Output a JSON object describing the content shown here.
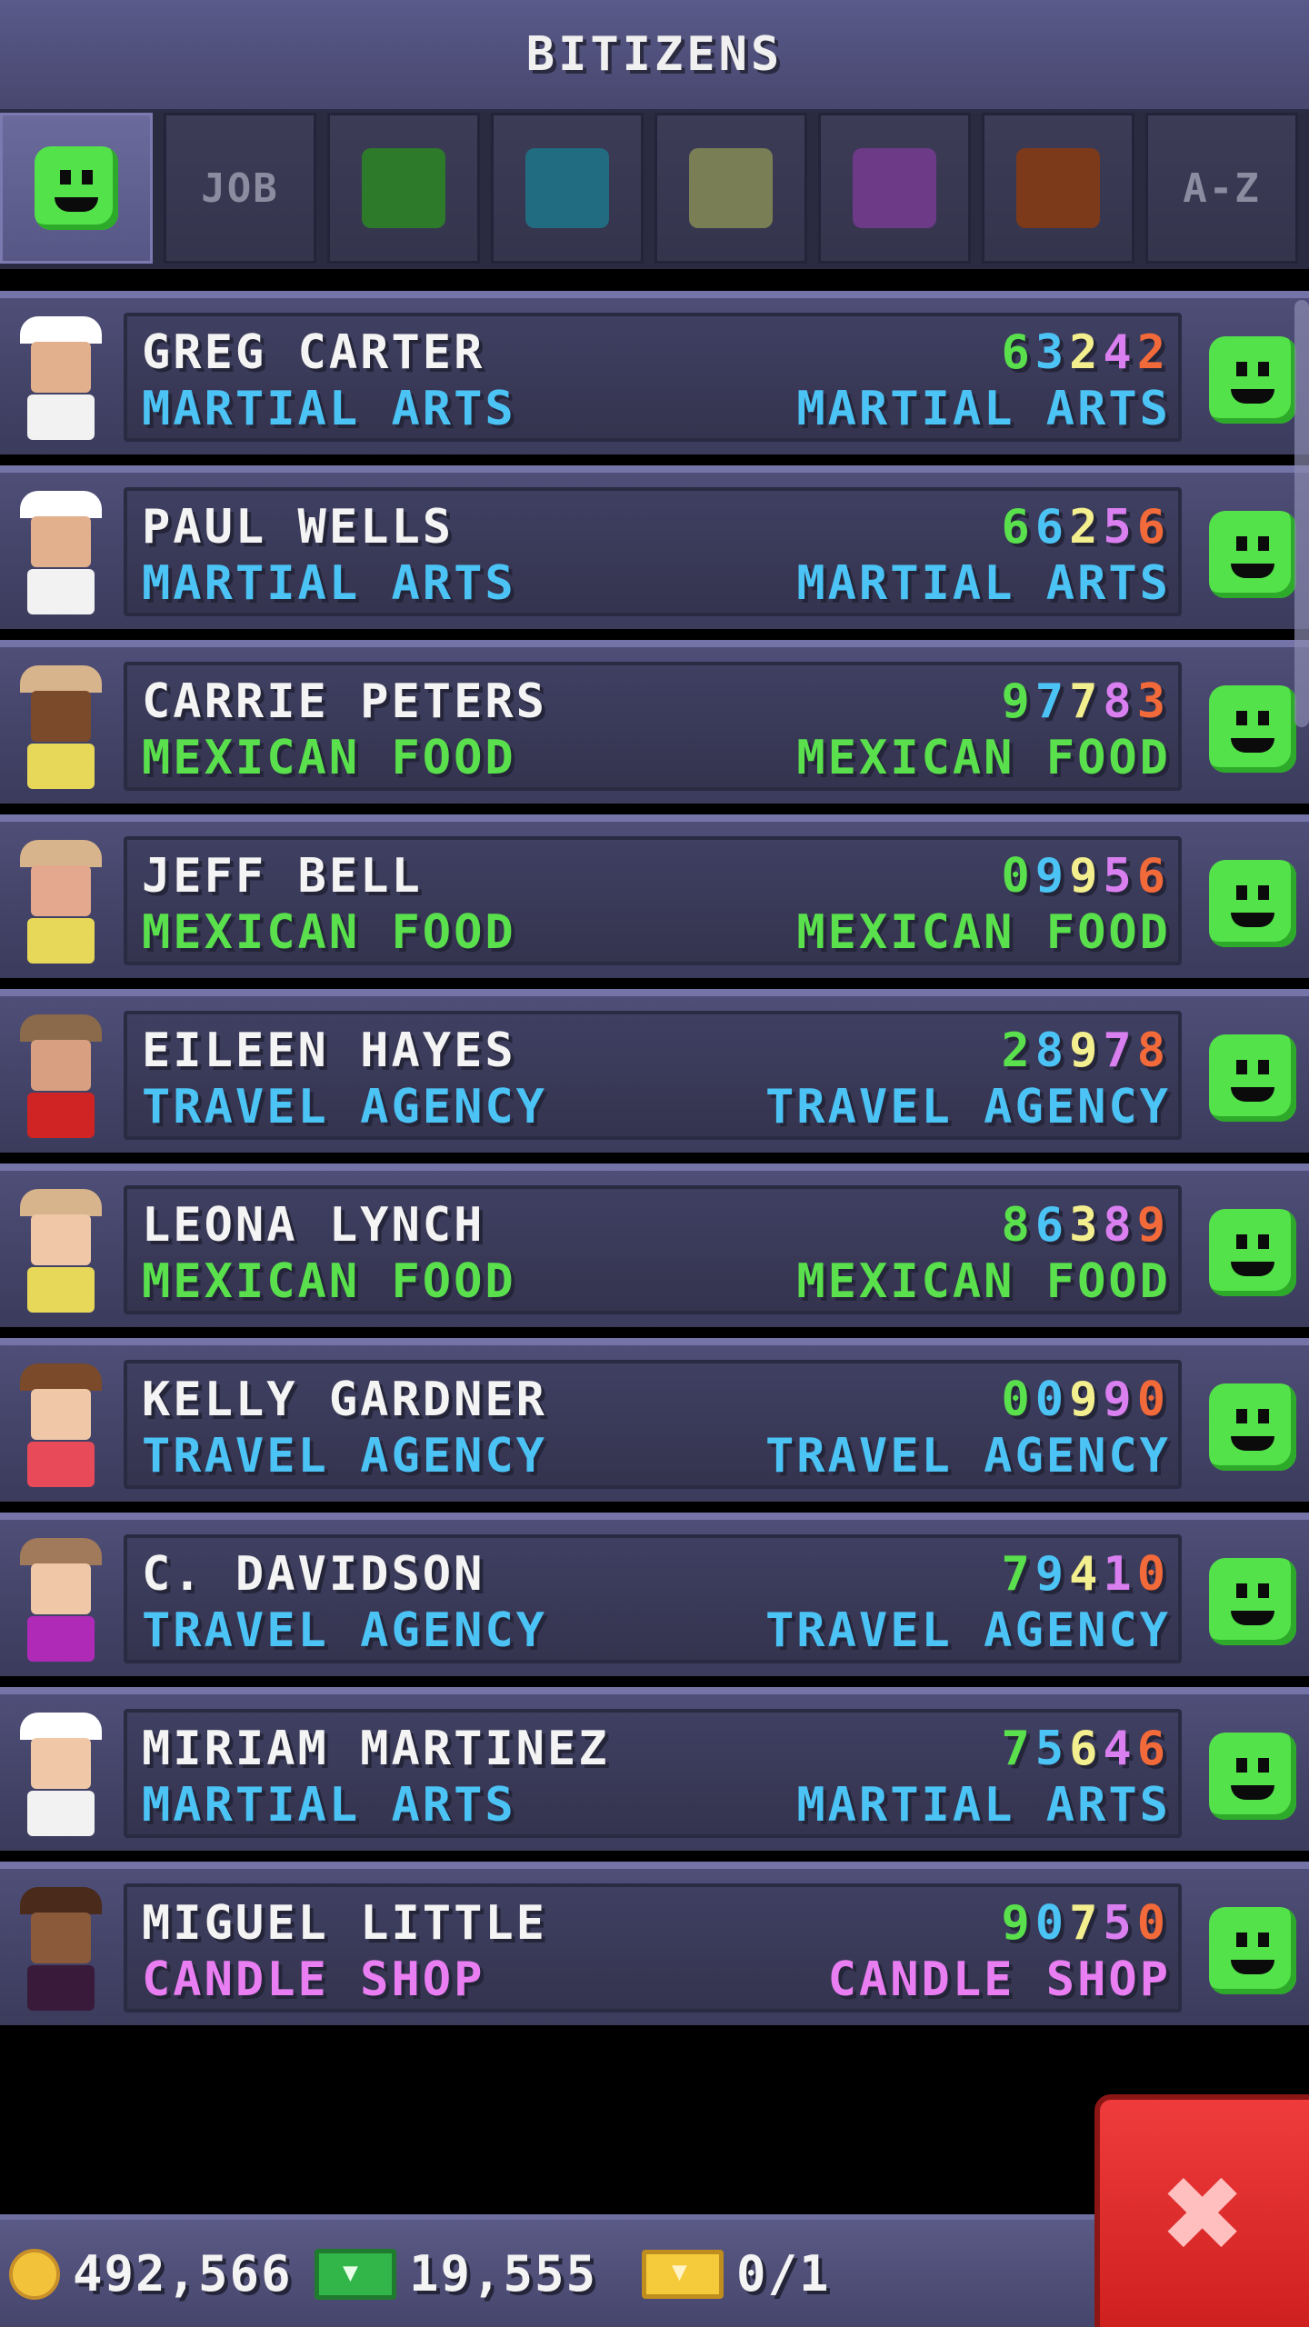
{
  "header": {
    "title": "BITIZENS"
  },
  "tabs": [
    {
      "type": "smiley"
    },
    {
      "type": "text",
      "label": "JOB"
    },
    {
      "type": "swatch",
      "color": "#2d7a2a"
    },
    {
      "type": "swatch",
      "color": "#226c82"
    },
    {
      "type": "swatch",
      "color": "#7a7e55"
    },
    {
      "type": "swatch",
      "color": "#6c3a86"
    },
    {
      "type": "swatch",
      "color": "#7c3a1a"
    },
    {
      "type": "text",
      "label": "A-Z"
    }
  ],
  "colors": {
    "martial": "#4cc3f5",
    "mexican": "#59e04c",
    "travel": "#4cc3f5",
    "candle": "#e97ef2",
    "digit_colors": [
      "#59e04c",
      "#4cc3f5",
      "#f4ef8e",
      "#d97ff0",
      "#f26a3a"
    ]
  },
  "bitizens": [
    {
      "name": "GREG CARTER",
      "digits": "63242",
      "job_left": "MARTIAL ARTS",
      "job_right": "MARTIAL ARTS",
      "job_color": "#4cc3f5",
      "avatar": {
        "hat": "#ffffff",
        "face": "#e3b08e",
        "shirt": "#f2f2f2"
      }
    },
    {
      "name": "PAUL WELLS",
      "digits": "66256",
      "job_left": "MARTIAL ARTS",
      "job_right": "MARTIAL ARTS",
      "job_color": "#4cc3f5",
      "avatar": {
        "hat": "#ffffff",
        "face": "#e3b08e",
        "shirt": "#f2f2f2"
      }
    },
    {
      "name": "CARRIE PETERS",
      "digits": "97783",
      "job_left": "MEXICAN FOOD",
      "job_right": "MEXICAN FOOD",
      "job_color": "#59e04c",
      "avatar": {
        "hat": "#d8b48c",
        "face": "#7b4a2b",
        "shirt": "#e8d85a"
      }
    },
    {
      "name": "JEFF BELL",
      "digits": "09956",
      "job_left": "MEXICAN FOOD",
      "job_right": "MEXICAN FOOD",
      "job_color": "#59e04c",
      "avatar": {
        "hat": "#d8b48c",
        "face": "#e3a88e",
        "shirt": "#e8d85a"
      }
    },
    {
      "name": "EILEEN HAYES",
      "digits": "28978",
      "job_left": "TRAVEL AGENCY",
      "job_right": "TRAVEL AGENCY",
      "job_color": "#4cc3f5",
      "avatar": {
        "hat": "#8a6a4a",
        "face": "#d8a080",
        "shirt": "#d02424"
      }
    },
    {
      "name": "LEONA LYNCH",
      "digits": "86389",
      "job_left": "MEXICAN FOOD",
      "job_right": "MEXICAN FOOD",
      "job_color": "#59e04c",
      "avatar": {
        "hat": "#d8b48c",
        "face": "#f0c8a8",
        "shirt": "#e8d85a"
      }
    },
    {
      "name": "KELLY GARDNER",
      "digits": "00990",
      "job_left": "TRAVEL AGENCY",
      "job_right": "TRAVEL AGENCY",
      "job_color": "#4cc3f5",
      "avatar": {
        "hat": "#7a4a2a",
        "face": "#f0c8a8",
        "shirt": "#e84a5a"
      }
    },
    {
      "name": "C. DAVIDSON",
      "digits": "79410",
      "job_left": "TRAVEL AGENCY",
      "job_right": "TRAVEL AGENCY",
      "job_color": "#4cc3f5",
      "avatar": {
        "hat": "#a07a5a",
        "face": "#f0c8a8",
        "shirt": "#b02ab8"
      }
    },
    {
      "name": "MIRIAM MARTINEZ",
      "digits": "75646",
      "job_left": "MARTIAL ARTS",
      "job_right": "MARTIAL ARTS",
      "job_color": "#4cc3f5",
      "avatar": {
        "hat": "#ffffff",
        "face": "#f0c8a8",
        "shirt": "#f2f2f2"
      }
    },
    {
      "name": "MIGUEL LITTLE",
      "digits": "90750",
      "job_left": "CANDLE SHOP",
      "job_right": "CANDLE SHOP",
      "job_color": "#e97ef2",
      "avatar": {
        "hat": "#4a2a1a",
        "face": "#8a5a3a",
        "shirt": "#3a1a3a"
      }
    }
  ],
  "bottom_bar": {
    "coins": "492,566",
    "bux": "19,555",
    "tickets": "0/1"
  }
}
